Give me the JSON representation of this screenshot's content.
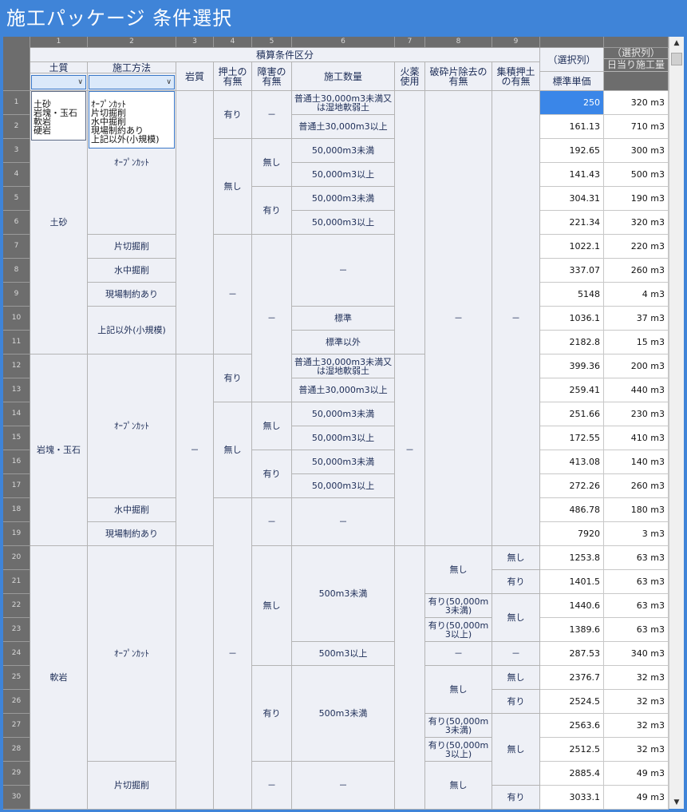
{
  "title": "施工パッケージ 条件選択",
  "column_numbers": [
    "1",
    "2",
    "3",
    "4",
    "5",
    "6",
    "7",
    "8",
    "9"
  ],
  "headers": {
    "group": "積算条件区分",
    "soil": "土質",
    "method": "施工方法",
    "rock": "岩質",
    "oshitsuchi": "押土の有無",
    "obstacle": "障害の有無",
    "quantity": "施工数量",
    "explosive": "火薬使用",
    "debris": "破砕片除去の有無",
    "collect": "集積押土の有無",
    "selected_col": "（選択列）",
    "unit_price": "標準単価",
    "daily_col": "（選択列）",
    "daily": "日当り施工量"
  },
  "soil_options": [
    "土砂",
    "岩塊・玉石",
    "軟岩",
    "硬岩"
  ],
  "method_options": [
    "ｵｰﾌﾟﾝｶｯﾄ",
    "片切掘削",
    "水中掘削",
    "現場制約あり",
    "上記以外(小規模)"
  ],
  "row_numbers": [
    "1",
    "2",
    "3",
    "4",
    "5",
    "6",
    "7",
    "8",
    "9",
    "10",
    "11",
    "12",
    "13",
    "14",
    "15",
    "16",
    "17",
    "18",
    "19",
    "20",
    "21",
    "22",
    "23",
    "24",
    "25",
    "26",
    "27",
    "28",
    "29",
    "30"
  ],
  "merged": {
    "soil_dosha": "土砂",
    "soil_gankai": "岩塊・玉石",
    "soil_nangan": "軟岩",
    "open_cut": "ｵｰﾌﾟﾝｶｯﾄ",
    "katakiri": "片切掘削",
    "suichu": "水中掘削",
    "genba": "現場制約あり",
    "jouki": "上記以外(小規模)",
    "ari": "有り",
    "nashi": "無し",
    "dash": "－",
    "hyojun": "標準",
    "hyojun_igai": "標準以外",
    "q_futsu_under": "普通土30,000m3未満又は湿地軟弱土",
    "q_futsu_over": "普通土30,000m3以上",
    "q_50k_under": "50,000m3未満",
    "q_50k_over": "50,000m3以上",
    "q_500_under": "500m3未満",
    "q_500_over": "500m3以上",
    "d_ari_under": "有り(50,000m3未満)",
    "d_ari_over": "有り(50,000m3以上)"
  },
  "prices": [
    "250",
    "161.13",
    "192.65",
    "141.43",
    "304.31",
    "221.34",
    "1022.1",
    "337.07",
    "5148",
    "1036.1",
    "2182.8",
    "399.36",
    "259.41",
    "251.66",
    "172.55",
    "413.08",
    "272.26",
    "486.78",
    "7920",
    "1253.8",
    "1401.5",
    "1440.6",
    "1389.6",
    "287.53",
    "2376.7",
    "2524.5",
    "2563.6",
    "2512.5",
    "2885.4",
    "3033.1"
  ],
  "daily": [
    "320 m3",
    "710 m3",
    "300 m3",
    "500 m3",
    "190 m3",
    "320 m3",
    "220 m3",
    "260 m3",
    "4 m3",
    "37 m3",
    "15 m3",
    "200 m3",
    "440 m3",
    "230 m3",
    "410 m3",
    "140 m3",
    "260 m3",
    "180 m3",
    "3 m3",
    "63 m3",
    "63 m3",
    "63 m3",
    "63 m3",
    "340 m3",
    "32 m3",
    "32 m3",
    "32 m3",
    "32 m3",
    "49 m3",
    "49 m3"
  ],
  "selected_row": 1,
  "colors": {
    "titlebar": "#3f84d8",
    "header_dark": "#6d6d6d",
    "cell_bg": "#eef0f6",
    "selection": "#3a86e8"
  }
}
